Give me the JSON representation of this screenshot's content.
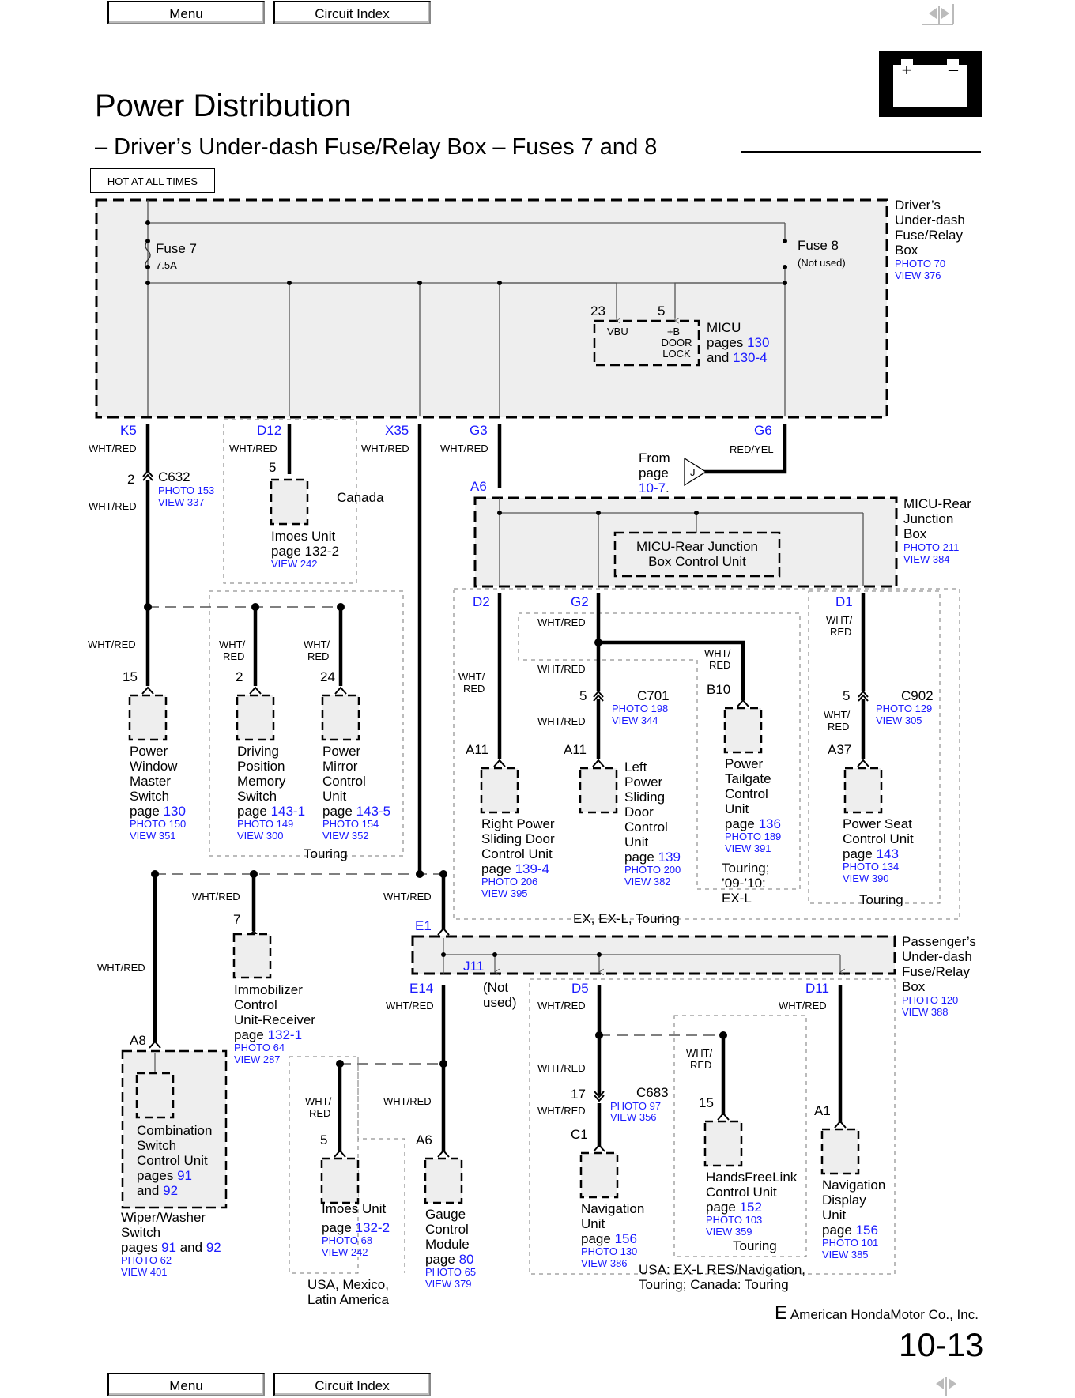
{
  "nav": {
    "menu_label": "Menu",
    "circuit_index_label": "Circuit Index",
    "prev_icon": "triangle-left",
    "next_icon": "triangle-right"
  },
  "header": {
    "title": "Power Distribution",
    "subtitle": "– Driver’s Under-dash Fuse/Relay Box – Fuses 7 and 8",
    "battery_icon": "battery-icon",
    "hot_label": "HOT AT ALL TIMES"
  },
  "colors": {
    "link": "#1a1aff",
    "box_fill": "#eeeeee",
    "text": "#000000"
  },
  "driver_box": {
    "name_lines": [
      "Driver’s",
      "Under-dash",
      "Fuse/Relay",
      "Box"
    ],
    "photo": "PHOTO 70",
    "view": "VIEW 376",
    "fuse7": {
      "label": "Fuse 7",
      "rating": "7.5A"
    },
    "fuse8": {
      "label": "Fuse 8",
      "note": "(Not used)"
    },
    "micu": {
      "pin23": "23",
      "pin5": "5",
      "vbu": "VBU",
      "b_lines": [
        "+B",
        "DOOR",
        "LOCK"
      ],
      "name": "MICU",
      "pages_prefix": "pages",
      "page1": "130",
      "and": "and",
      "page2": "130-4"
    }
  },
  "wires": {
    "wht_red": "WHT/RED",
    "wht": "WHT/",
    "red": "RED",
    "red_yel": "RED/YEL"
  },
  "pins": {
    "k5": "K5",
    "d12": "D12",
    "x35": "X35",
    "g3": "G3",
    "g6": "G6",
    "a6_top": "A6",
    "d2": "D2",
    "g2": "G2",
    "d1": "D1",
    "e1": "E1",
    "j11": "J11",
    "e14": "E14",
    "d5": "D5",
    "d11": "D11"
  },
  "c632": {
    "pin": "2",
    "name": "C632",
    "photo": "PHOTO 153",
    "view": "VIEW 337"
  },
  "imoes_canada": {
    "pin": "5",
    "name": "Imoes Unit",
    "page": "page 132-2",
    "view": "VIEW 242",
    "region": "Canada"
  },
  "from_page": {
    "lines": [
      "From",
      "page"
    ],
    "page": "10-7",
    "dot": ".",
    "connector": "J"
  },
  "micu_rear": {
    "name_lines": [
      "MICU-Rear",
      "Junction",
      "Box"
    ],
    "photo": "PHOTO 211",
    "view": "VIEW 384",
    "control_unit_lines": [
      "MICU-Rear Junction",
      "Box Control Unit"
    ]
  },
  "components_left": [
    {
      "pin": "15",
      "lines": [
        "Power",
        "Window",
        "Master",
        "Switch"
      ],
      "page": "130",
      "photo": "PHOTO 150",
      "view": "VIEW 351"
    },
    {
      "pin": "2",
      "lines": [
        "Driving",
        "Position",
        "Memory",
        "Switch"
      ],
      "page": "143-1",
      "photo": "PHOTO 149",
      "view": "VIEW 300"
    },
    {
      "pin": "24",
      "lines": [
        "Power",
        "Mirror",
        "Control",
        "Unit"
      ],
      "page": "143-5",
      "photo": "PHOTO 154",
      "view": "VIEW 352"
    }
  ],
  "touring_label": "Touring",
  "page_prefix": "page",
  "components_rear": [
    {
      "pin": "A11",
      "lines": [
        "Right Power",
        "Sliding Door",
        "Control Unit"
      ],
      "page": "139-4",
      "photo": "PHOTO 206",
      "view": "VIEW 395"
    },
    {
      "pin": "A11",
      "lines": [
        "Left",
        "Power",
        "Sliding",
        "Door",
        "Control",
        "Unit"
      ],
      "page": "139",
      "photo": "PHOTO 200",
      "view": "VIEW 382"
    },
    {
      "pin": "B10",
      "lines": [
        "Power",
        "Tailgate",
        "Control",
        "Unit"
      ],
      "page": "136",
      "photo": "PHOTO 189",
      "view": "VIEW 391"
    },
    {
      "pin": "A37",
      "lines": [
        "Power Seat",
        "Control Unit"
      ],
      "page": "143",
      "photo": "PHOTO 134",
      "view": "VIEW 390"
    }
  ],
  "c701": {
    "pin": "5",
    "name": "C701",
    "photo": "PHOTO 198",
    "view": "VIEW 344"
  },
  "c902": {
    "pin": "5",
    "name": "C902",
    "photo": "PHOTO 129",
    "view": "VIEW 305"
  },
  "tailgate_region": [
    "Touring;",
    "’09-’10:",
    "EX-L"
  ],
  "rear_region": "EX, EX-L, Touring",
  "immobilizer": {
    "pin": "7",
    "lines": [
      "Immobilizer",
      "Control",
      "Unit-Receiver"
    ],
    "page": "132-1",
    "photo": "PHOTO 64",
    "view": "VIEW 287"
  },
  "combination": {
    "pin": "A8",
    "inner_lines": [
      "Combination",
      "Switch",
      "Control Unit"
    ],
    "pages_prefix": "pages",
    "page1": "91",
    "and": "and",
    "page2": "92",
    "outer_lines": [
      "Wiper/Washer",
      "Switch"
    ],
    "outer_page1": "91",
    "outer_page2": "92",
    "photo": "PHOTO 62",
    "view": "VIEW 401"
  },
  "passenger_box": {
    "name_lines": [
      "Passenger’s",
      "Under-dash",
      "Fuse/Relay",
      "Box"
    ],
    "photo": "PHOTO 120",
    "view": "VIEW 388",
    "j11_note_lines": [
      "(Not",
      "used)"
    ]
  },
  "imoes_usa": {
    "pin": "5",
    "name": "Imoes Unit",
    "page": "132-2",
    "photo": "PHOTO 68",
    "view": "VIEW 242",
    "region_lines": [
      "USA, Mexico,",
      "Latin America"
    ]
  },
  "gauge": {
    "pin": "A6",
    "lines": [
      "Gauge",
      "Control",
      "Module"
    ],
    "page": "80",
    "photo": "PHOTO 65",
    "view": "VIEW 379"
  },
  "c683": {
    "pin": "17",
    "name": "C683",
    "photo": "PHOTO 97",
    "view": "VIEW 356"
  },
  "nav_unit": {
    "pin": "C1",
    "lines": [
      "Navigation",
      "Unit"
    ],
    "page": "156",
    "photo": "PHOTO 130",
    "view": "VIEW 386"
  },
  "hfl": {
    "pin": "15",
    "lines": [
      "HandsFreeLink",
      "Control Unit"
    ],
    "page": "152",
    "photo": "PHOTO 103",
    "view": "VIEW 359",
    "region": "Touring"
  },
  "nav_display": {
    "pin": "A1",
    "lines": [
      "Navigation",
      "Display",
      "Unit"
    ],
    "page": "156",
    "photo": "PHOTO 101",
    "view": "VIEW 385"
  },
  "nav_region_lines": [
    "USA: EX-L RES/Navigation,",
    "Touring; Canada: Touring"
  ],
  "footer": {
    "mark": "E",
    "company": "American HondaMotor Co., Inc.",
    "page_number": "10-13"
  }
}
